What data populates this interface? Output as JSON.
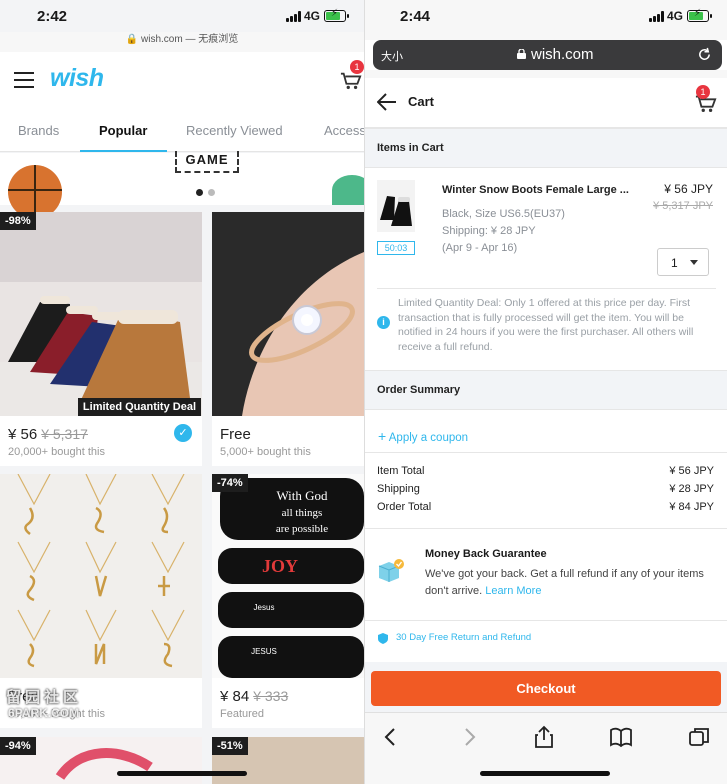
{
  "left": {
    "status": {
      "time": "2:42",
      "network": "4G"
    },
    "url_text": "wish.com — 无痕浏览",
    "logo": "wish",
    "cart_badge": "1",
    "tabs": [
      "Brands",
      "Popular",
      "Recently Viewed",
      "Access"
    ],
    "active_tab": "Popular",
    "banner_label": "GAME",
    "products": [
      {
        "discount": "-98%",
        "badge": "Limited Quantity Deal",
        "price": "¥ 56",
        "old_price": "¥ 5,317",
        "sub": "20,000+ bought this",
        "verified": true
      },
      {
        "discount": "",
        "price": "Free",
        "old_price": "",
        "sub": "5,000+ bought this"
      },
      {
        "discount": "",
        "price": "Free",
        "old_price": "",
        "sub": "10,000+ bought this"
      },
      {
        "discount": "-74%",
        "price": "¥ 84",
        "old_price": "¥ 333",
        "sub": "Featured"
      },
      {
        "discount": "-94%"
      },
      {
        "discount": "-51%"
      }
    ],
    "mask_texts": [
      "With God",
      "all things",
      "are possible",
      "JOY",
      "Jesus",
      "JESUS"
    ],
    "watermark": "留园社区",
    "watermark_url": "6PARK.COM"
  },
  "right": {
    "status": {
      "time": "2:44",
      "network": "4G"
    },
    "browser": {
      "text_size": "大小",
      "domain": "wish.com"
    },
    "cart_title": "Cart",
    "cart_badge": "1",
    "items_header": "Items in Cart",
    "item": {
      "name": "Winter Snow Boots Female Large ...",
      "variant": "Black, Size US6.5(EU37)",
      "shipping": "Shipping: ¥ 28 JPY",
      "delivery": "(Apr 9 - Apr 16)",
      "price": "¥ 56 JPY",
      "old_price": "¥ 5,317 JPY",
      "timer": "50:03",
      "quantity": "1"
    },
    "notice": "Limited Quantity Deal: Only 1 offered at this price per day. First transaction that is fully processed will get the item. You will be notified in 24 hours if you were the first purchaser. All others will receive a full refund.",
    "summary_header": "Order Summary",
    "coupon": "Apply a coupon",
    "summary": [
      {
        "label": "Item Total",
        "value": "¥ 56 JPY"
      },
      {
        "label": "Shipping",
        "value": "¥ 28 JPY"
      },
      {
        "label": "Order Total",
        "value": "¥ 84 JPY"
      }
    ],
    "guarantee": {
      "title": "Money Back Guarantee",
      "text": "We've got your back. Get a full refund if any of your items don't arrive.",
      "link": "Learn More"
    },
    "returns": "30 Day Free Return and Refund",
    "checkout": "Checkout"
  },
  "colors": {
    "wish_blue": "#2fb7ec",
    "checkout_orange": "#f15a24",
    "badge_red": "#e8353f"
  }
}
